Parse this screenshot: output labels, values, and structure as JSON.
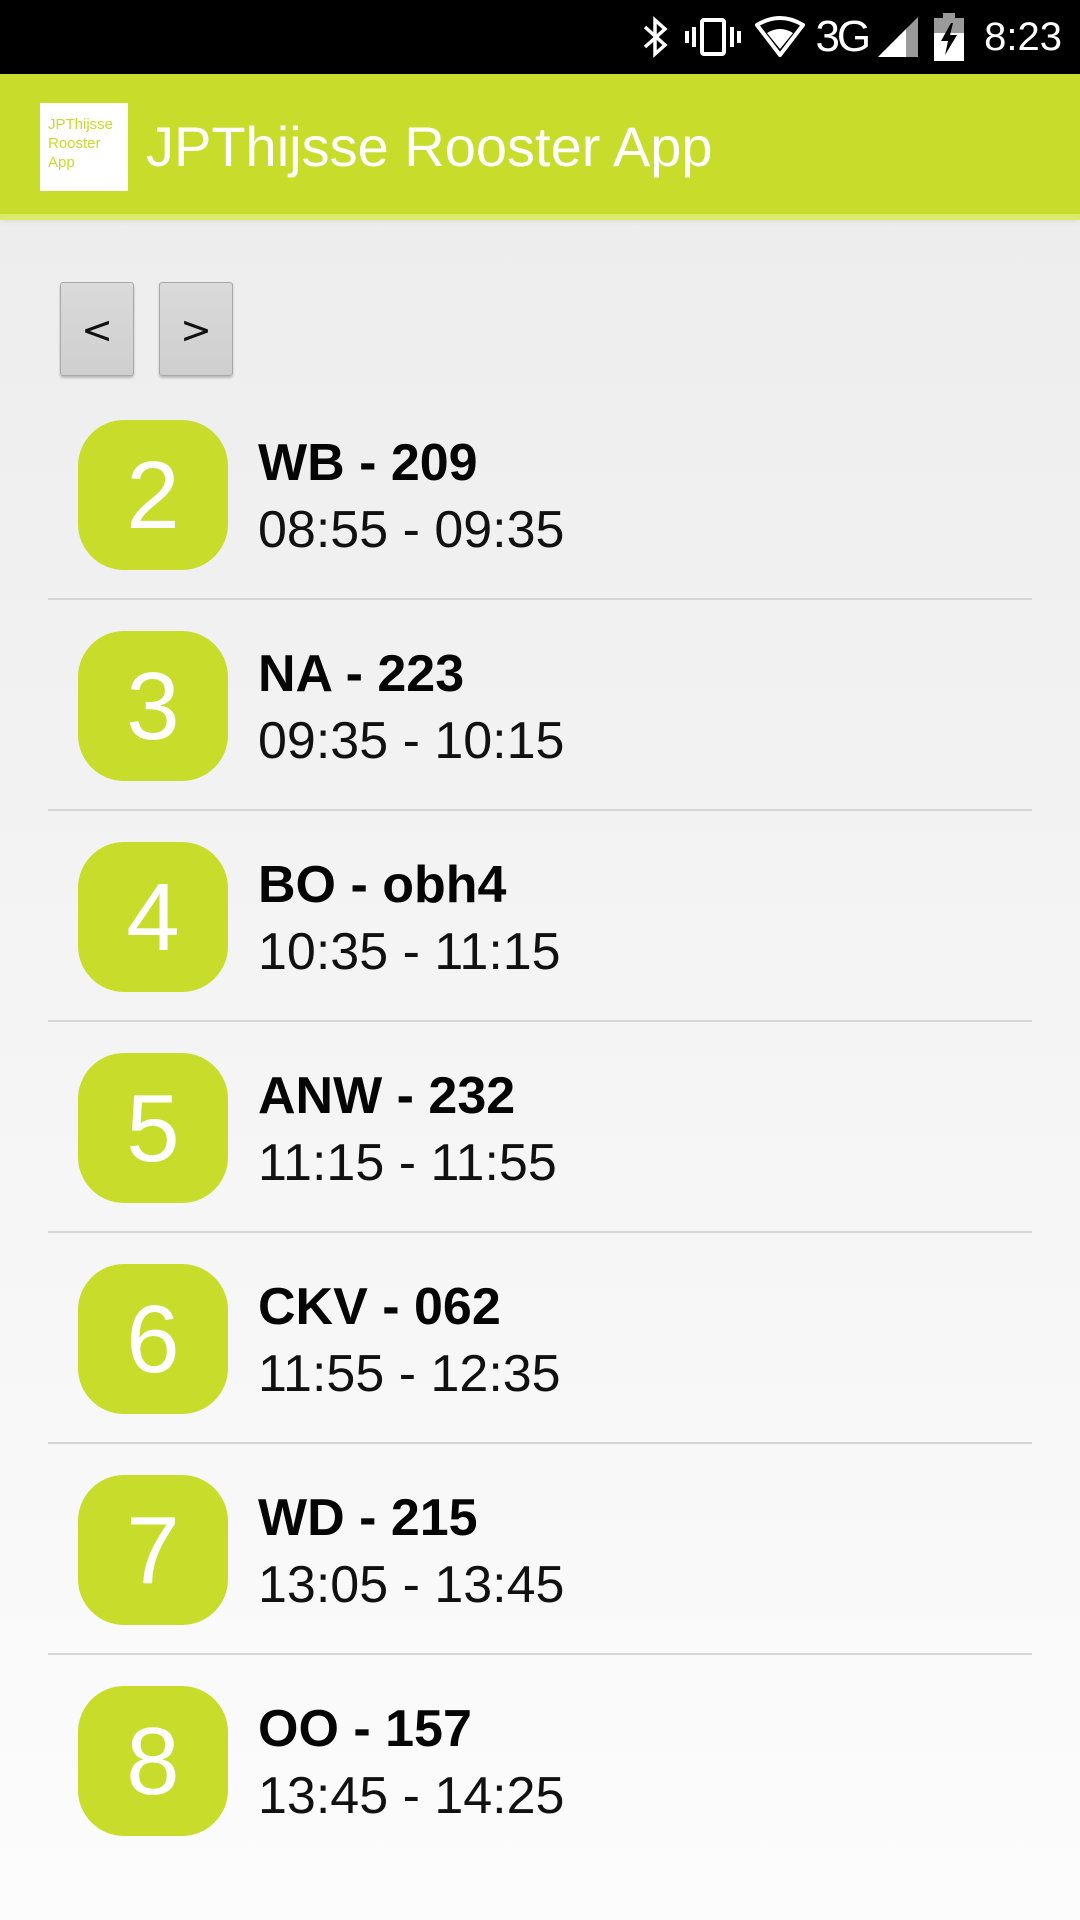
{
  "status_bar": {
    "time": "8:23",
    "network": "3G",
    "icons": [
      "bluetooth-icon",
      "vibrate-icon",
      "wifi-icon",
      "signal-icon",
      "battery-charging-icon"
    ]
  },
  "app_bar": {
    "title": "JPThijsse Rooster App",
    "logo_lines": [
      "JPThijsse",
      "Rooster",
      "App"
    ],
    "color": "#c8dc2b"
  },
  "navigation": {
    "prev_label": "<",
    "next_label": ">"
  },
  "lessons": [
    {
      "period": "2",
      "subject": "WB - 209",
      "time": "08:55 - 09:35"
    },
    {
      "period": "3",
      "subject": "NA - 223",
      "time": "09:35 - 10:15"
    },
    {
      "period": "4",
      "subject": "BO - obh4",
      "time": "10:35 - 11:15"
    },
    {
      "period": "5",
      "subject": "ANW - 232",
      "time": "11:15 - 11:55"
    },
    {
      "period": "6",
      "subject": "CKV - 062",
      "time": "11:55 - 12:35"
    },
    {
      "period": "7",
      "subject": "WD - 215",
      "time": "13:05 - 13:45"
    },
    {
      "period": "8",
      "subject": "OO - 157",
      "time": "13:45 - 14:25"
    }
  ]
}
